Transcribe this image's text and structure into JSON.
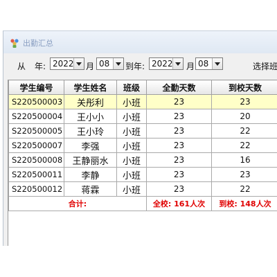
{
  "window": {
    "title": "出勤汇总"
  },
  "toolbar": {
    "from_label": "从",
    "year_label": "年:",
    "month_label": "月",
    "to_year_label": "到年:",
    "to_month_label": "月",
    "class_label": "选择班",
    "from_year": "2022",
    "from_month": "08",
    "to_year": "2022",
    "to_month": "08"
  },
  "table": {
    "columns": [
      "学生编号",
      "学生姓名",
      "班级",
      "全勤天数",
      "到校天数"
    ],
    "rows": [
      {
        "id": "S220500003",
        "name": "关彤利",
        "class": "小班",
        "full": "23",
        "arrived": "23"
      },
      {
        "id": "S220500004",
        "name": "王小小",
        "class": "小班",
        "full": "23",
        "arrived": "20"
      },
      {
        "id": "S220500005",
        "name": "王小玲",
        "class": "小班",
        "full": "23",
        "arrived": "22"
      },
      {
        "id": "S220500007",
        "name": "李强",
        "class": "小班",
        "full": "23",
        "arrived": "22"
      },
      {
        "id": "S220500008",
        "name": "王静丽水",
        "class": "小班",
        "full": "23",
        "arrived": "16"
      },
      {
        "id": "S220500011",
        "name": "李静",
        "class": "小班",
        "full": "23",
        "arrived": "23"
      },
      {
        "id": "S220500012",
        "name": "蒋霖",
        "class": "小班",
        "full": "23",
        "arrived": "22"
      }
    ],
    "total": {
      "label": "合计:",
      "full": "全校: 161人次",
      "arrived": "到校: 148人次"
    }
  },
  "colors": {
    "selected_row": "#ffffc8",
    "total_text": "#e00000"
  }
}
